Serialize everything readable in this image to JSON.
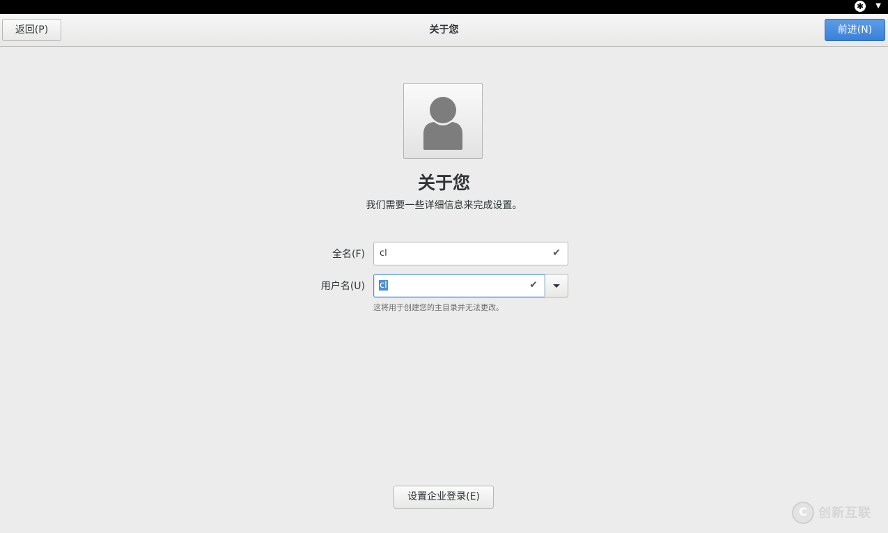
{
  "topbar": {
    "icons": [
      "accessibility-icon",
      "caret-down-icon"
    ]
  },
  "header": {
    "back_label": "返回(P)",
    "title": "关于您",
    "next_label": "前进(N)"
  },
  "main": {
    "avatar_icon": "user-avatar-icon",
    "title": "关于您",
    "subtitle": "我们需要一些详细信息来完成设置。"
  },
  "form": {
    "fullname_label": "全名(F)",
    "fullname_value": "cl",
    "username_label": "用户名(U)",
    "username_value": "cl",
    "username_hint": "这将用于创建您的主目录并无法更改。"
  },
  "footer": {
    "enterprise_label": "设置企业登录(E)"
  },
  "watermark": {
    "logo_icon": "brand-logo-icon",
    "text": "创新互联"
  },
  "colors": {
    "accent": "#4a90d9",
    "background": "#ececec"
  }
}
